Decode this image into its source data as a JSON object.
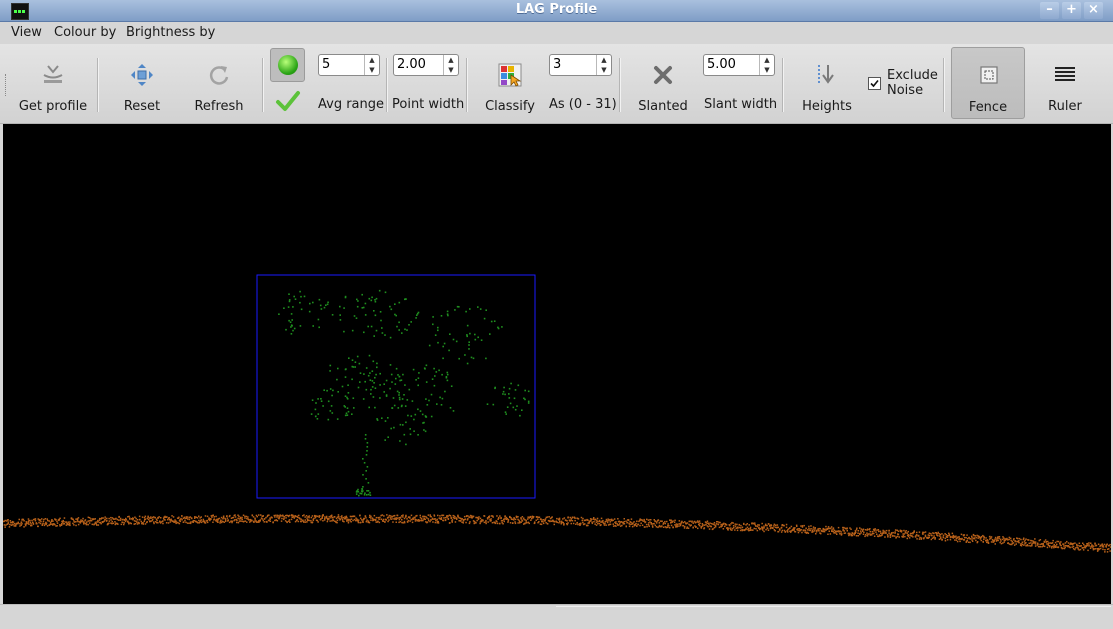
{
  "window": {
    "title": "LAG Profile"
  },
  "menubar": {
    "items": [
      "View",
      "Colour by",
      "Brightness by"
    ]
  },
  "toolbar": {
    "get_profile_label": "Get profile",
    "reset_label": "Reset",
    "refresh_label": "Refresh",
    "avg_range": {
      "value": "5",
      "label": "Avg range"
    },
    "point_width": {
      "value": "2.00",
      "label": "Point width"
    },
    "classify_label": "Classify",
    "classify_as": {
      "value": "3",
      "label": "As (0 - 31)"
    },
    "slanted_label": "Slanted",
    "slant_width": {
      "value": "5.00",
      "label": "Slant width"
    },
    "heights_label": "Heights",
    "exclude_noise": {
      "label_line1": "Exclude",
      "label_line2": "Noise",
      "checked": true
    },
    "fence_label": "Fence",
    "ruler_label": "Ruler"
  },
  "colors": {
    "canvas_bg": "#000000",
    "fence_rect": "#1a1aff",
    "vegetation": "#1f8f1f",
    "ground": "#b8611a"
  }
}
